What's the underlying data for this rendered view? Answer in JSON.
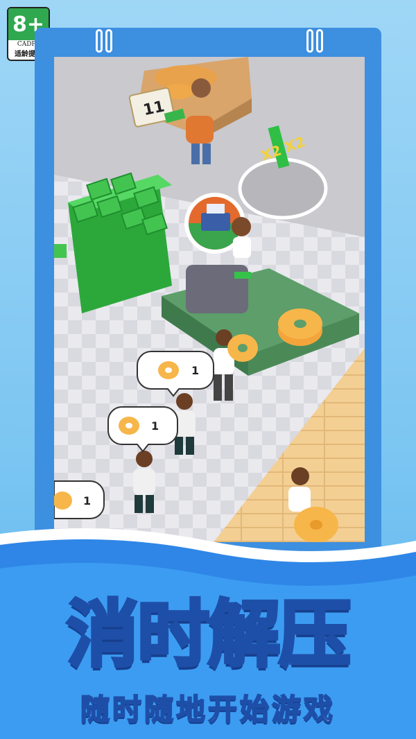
{
  "age_rating": {
    "label": "8+",
    "org": "CADPA",
    "tip": "适龄提示"
  },
  "scene": {
    "counter_stack_count": "11",
    "multiplier_text": "X2 X2",
    "order_bubbles": [
      {
        "count": "1"
      },
      {
        "count": "1"
      },
      {
        "count": "1"
      }
    ]
  },
  "headline": {
    "chars": [
      "消",
      "时",
      "解",
      "压"
    ]
  },
  "subline": "随时随地开始游戏",
  "colors": {
    "frame": "#3d8fe0",
    "headline_fill": "#ffffff",
    "headline_accent": "#ffd23a",
    "outline": "#1e4fa8"
  }
}
